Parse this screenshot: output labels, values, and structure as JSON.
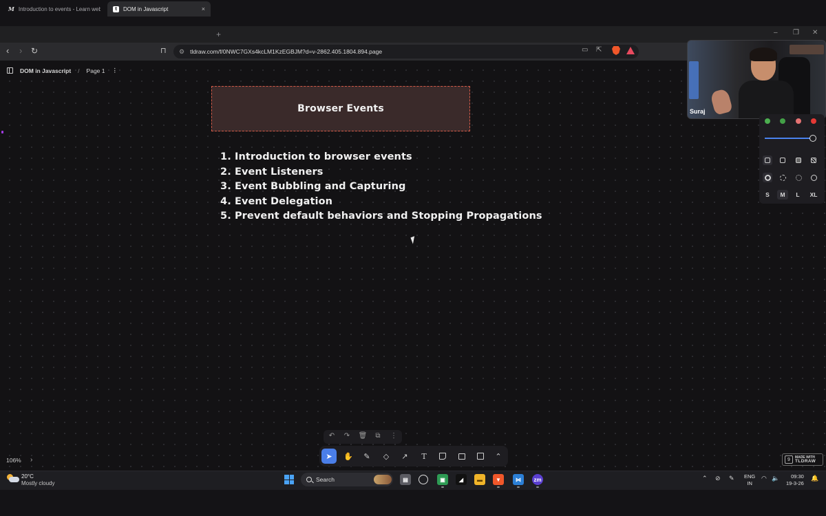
{
  "browser": {
    "tabs": [
      {
        "icon": "M",
        "label": "Introduction to events - Learn web d",
        "active": false
      },
      {
        "icon": "t",
        "label": "DOM in Javascript",
        "active": true
      }
    ],
    "close_glyph": "×",
    "new_tab_glyph": "+",
    "url": "tldraw.com/f/0NWC7GXs4kcLM1KzEGBJM?d=v-2862.405.1804.894.page"
  },
  "app": {
    "breadcrumb": {
      "document": "DOM in Javascript",
      "separator": "/",
      "page": "Page 1",
      "more": "⋮"
    },
    "title_card": {
      "text": "Browser Events",
      "fill_color": "#3a2a2a",
      "border_color": "#d55a47"
    },
    "topics": [
      "1. Introduction to browser events",
      "2. Event Listeners",
      "3. Event Bubbling and Capturing",
      "4. Event Delegation",
      "5. Prevent default behaviors and Stopping Propagations"
    ],
    "zoom_level": "106%",
    "style_panel": {
      "colors": [
        "#4caf50",
        "#43a047",
        "#e57373",
        "#e53935"
      ],
      "opacity": 1.0,
      "sizes": [
        "S",
        "M",
        "L",
        "XL"
      ],
      "selected_size": "M"
    },
    "toolbar": {
      "tools": [
        "select-tool",
        "hand-tool",
        "draw-tool",
        "eraser-tool",
        "arrow-tool",
        "text-tool",
        "note-tool",
        "image-tool",
        "rectangle-tool",
        "more-tools"
      ],
      "selected_tool": "select-tool",
      "accent": "#4a7ee8"
    },
    "made_with": {
      "line1": "MADE WITH",
      "line2": "TLDRAW"
    }
  },
  "webcam": {
    "name": "Suraj"
  },
  "taskbar": {
    "weather_temp": "20°C",
    "weather_desc": "Mostly cloudy",
    "search_label": "Search",
    "lang_1": "ENG",
    "lang_2": "IN",
    "time": "09:30",
    "date": "19-3-26"
  }
}
